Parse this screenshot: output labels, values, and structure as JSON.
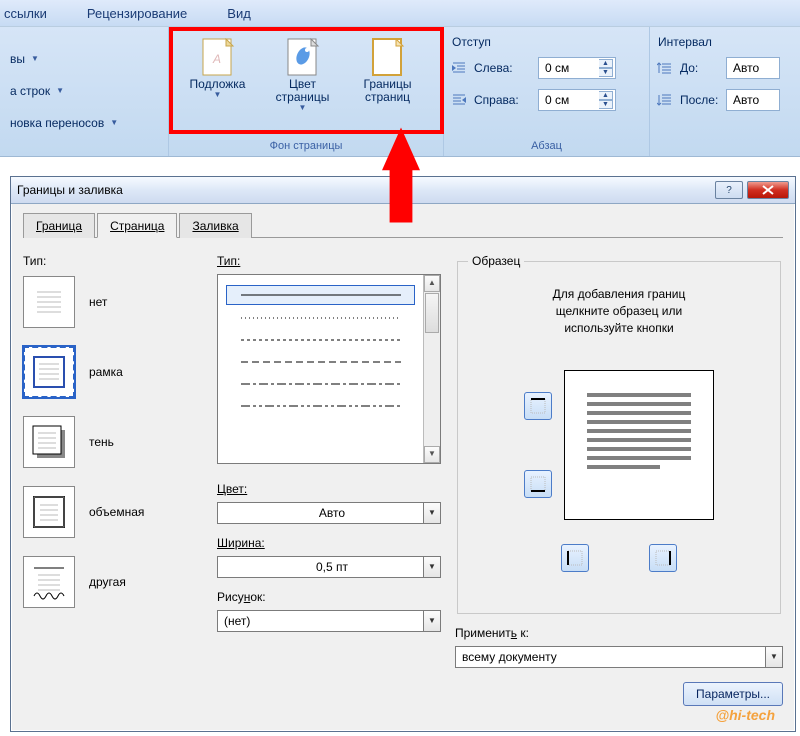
{
  "menubar": {
    "item1": "ссылки",
    "item2": "Рецензирование",
    "item3": "Вид"
  },
  "ribbon": {
    "left": {
      "row1": "вы",
      "row2": "а строк",
      "row3": "новка переносов"
    },
    "bg_group": {
      "watermark": "Подложка",
      "pagecolor": "Цвет\nстраницы",
      "borders": "Границы\nстраниц",
      "title": "Фон страницы"
    },
    "indent": {
      "title": "Отступ",
      "left_lbl": "Слева:",
      "right_lbl": "Справа:",
      "val": "0 см"
    },
    "interval": {
      "title": "Интервал",
      "before_lbl": "До:",
      "after_lbl": "После:",
      "val": "Авто"
    },
    "para_title": "Абзац"
  },
  "dialog": {
    "title": "Границы и заливка",
    "tabs": {
      "t1": "Граница",
      "t2": "Страница",
      "t3": "Заливка"
    },
    "type": {
      "label": "Тип:",
      "none": "нет",
      "box": "рамка",
      "shadow": "тень",
      "threeD": "объемная",
      "custom": "другая"
    },
    "style": {
      "label": "Тип:"
    },
    "color": {
      "label": "Цвет:",
      "value": "Авто"
    },
    "width": {
      "label": "Ширина:",
      "value": "0,5 пт"
    },
    "art": {
      "label": "Рисунок:",
      "value": "(нет)"
    },
    "preview": {
      "label": "Образец",
      "hint1": "Для добавления границ",
      "hint2": "щелкните образец или",
      "hint3": "используйте кнопки"
    },
    "apply": {
      "label": "Применить к:",
      "value": "всему документу"
    },
    "options": "Параметры..."
  },
  "watermark": "@hi-tech"
}
